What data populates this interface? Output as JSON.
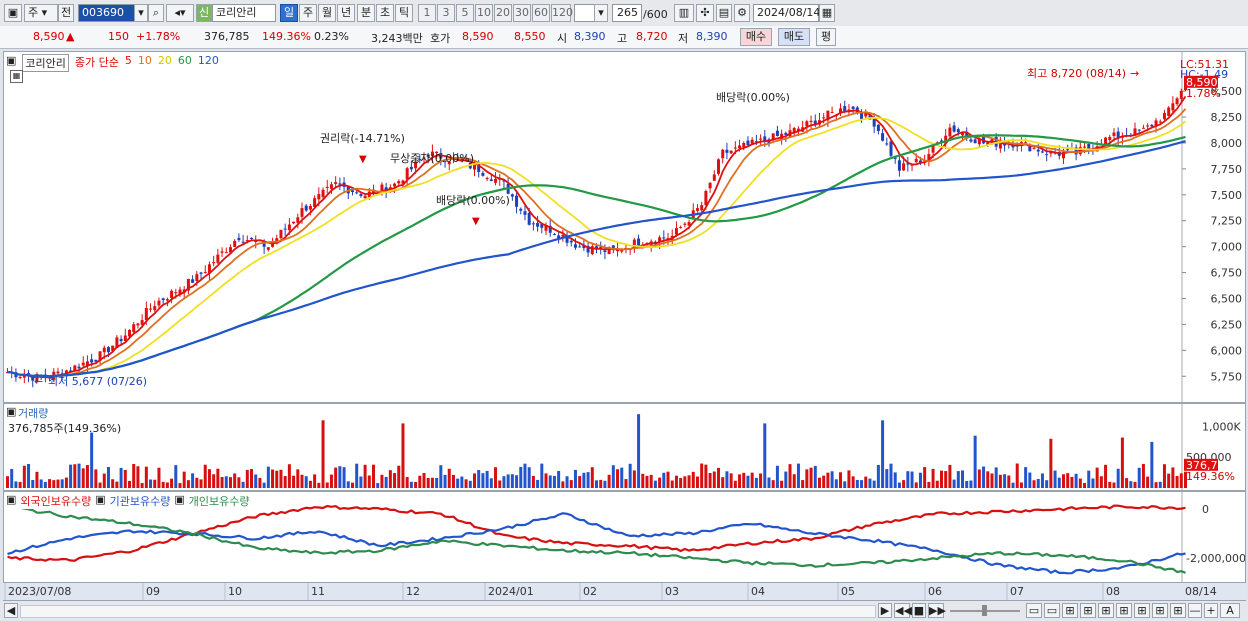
{
  "toolbar": {
    "mode1": "주",
    "mode2": "전",
    "code": "003690",
    "name_badge": "신",
    "name": "코리안리",
    "periods": [
      "일",
      "주",
      "월",
      "년",
      "분",
      "초",
      "틱"
    ],
    "numbers": [
      "1",
      "3",
      "5",
      "10",
      "20",
      "30",
      "60",
      "120"
    ],
    "count": "265",
    "count_total": "/600",
    "date": "2024/08/14"
  },
  "info": {
    "price": "8,590",
    "arrow": "▲",
    "change": "150",
    "change_pct": "+1.78%",
    "volume": "376,785",
    "volume_ratio": "149.36%",
    "turnover": "0.23%",
    "amount": "3,243백만",
    "quote_label": "호가",
    "ask": "8,590",
    "bid": "8,550",
    "open_label": "시",
    "open": "8,390",
    "high_label": "고",
    "high": "8,720",
    "low_label": "저",
    "low": "8,390",
    "buy": "매수",
    "sell": "매도",
    "avg": "평"
  },
  "price_panel": {
    "title": "코리안리",
    "close_label": "종가 단순",
    "ma": [
      "5",
      "10",
      "20",
      "60",
      "120"
    ],
    "ma_colors": [
      "#e01010",
      "#e07020",
      "#f0e020",
      "#229944",
      "#2255cc"
    ],
    "lc": "LC:51.31",
    "hc": "HC:-1.49",
    "last_price": "8,590",
    "last_pct": "1.78%",
    "high_note": "최고 8,720 (08/14)",
    "low_note": "최저 5,677 (07/26)",
    "events": [
      "권리락(-14.71%)",
      "무상증자(0.00%)",
      "배당락(0.00%)",
      "배당락(0.00%)"
    ]
  },
  "volume_panel": {
    "title": "거래량",
    "current": "376,785주(149.36%)",
    "ticks": [
      "1,000K",
      "500,000"
    ],
    "last_value": "376,785",
    "last_pct": "149.36%"
  },
  "holding_panel": {
    "legend": [
      "외국인보유수량",
      "기관보유수량",
      "개인보유수량"
    ],
    "colors": [
      "#d61010",
      "#2255cc",
      "#2e8b4e"
    ],
    "ticks": [
      "0",
      "-2,000,000"
    ]
  },
  "x_axis": {
    "labels": [
      "2023/07/08",
      "09",
      "10",
      "11",
      "12",
      "2024/01",
      "02",
      "03",
      "04",
      "05",
      "06",
      "07",
      "08"
    ],
    "current_date": "08/14"
  },
  "chart_data": {
    "type": "candlestick",
    "y_ticks": [
      5750,
      6000,
      6250,
      6500,
      6750,
      7000,
      7250,
      7500,
      7750,
      8000,
      8250,
      8500
    ],
    "ylim": [
      5550,
      8800
    ],
    "close_path": [
      [
        0,
        5790
      ],
      [
        8,
        5730
      ],
      [
        15,
        5820
      ],
      [
        22,
        5950
      ],
      [
        28,
        6150
      ],
      [
        35,
        6450
      ],
      [
        45,
        6700
      ],
      [
        55,
        7100
      ],
      [
        62,
        7000
      ],
      [
        70,
        7350
      ],
      [
        78,
        7600
      ],
      [
        85,
        7500
      ],
      [
        92,
        7600
      ],
      [
        100,
        7900
      ],
      [
        105,
        7850
      ],
      [
        112,
        7750
      ],
      [
        118,
        7600
      ],
      [
        124,
        7250
      ],
      [
        130,
        7150
      ],
      [
        136,
        7000
      ],
      [
        144,
        6950
      ],
      [
        150,
        7050
      ],
      [
        158,
        7100
      ],
      [
        165,
        7400
      ],
      [
        170,
        7900
      ],
      [
        178,
        8000
      ],
      [
        186,
        8100
      ],
      [
        194,
        8250
      ],
      [
        200,
        8350
      ],
      [
        206,
        8200
      ],
      [
        212,
        7750
      ],
      [
        218,
        7850
      ],
      [
        224,
        8150
      ],
      [
        232,
        8000
      ],
      [
        240,
        8000
      ],
      [
        248,
        7900
      ],
      [
        254,
        7900
      ],
      [
        262,
        8050
      ],
      [
        270,
        8120
      ],
      [
        276,
        8300
      ],
      [
        280,
        8590
      ]
    ],
    "total_days": 280,
    "volume_spikes": [
      [
        20,
        900000
      ],
      [
        75,
        1100000
      ],
      [
        94,
        1050000
      ],
      [
        150,
        1200000
      ],
      [
        180,
        1050000
      ],
      [
        208,
        1100000
      ],
      [
        230,
        850000
      ],
      [
        248,
        800000
      ],
      [
        265,
        820000
      ],
      [
        272,
        750000
      ]
    ],
    "holdings": {
      "foreign": [
        -2000000,
        -2100000,
        -1700000,
        -1000000,
        -300000,
        100000,
        0,
        -200000,
        -1100000,
        -1400000,
        -1500000,
        -1700000,
        -1400000,
        -1200000,
        -600000,
        -200000,
        -100000,
        0,
        100000,
        50000
      ],
      "institution": [
        -1800000,
        -1200000,
        -900000,
        -1000000,
        -1200000,
        -900000,
        -1500000,
        -1200000,
        -800000,
        -200000,
        -1100000,
        -1000000,
        -600000,
        -1000000,
        -1300000,
        -1700000,
        -2300000,
        -2600000,
        -2400000,
        -1800000
      ],
      "individual": [
        100000,
        -300000,
        -600000,
        -1000000,
        -1600000,
        -1800000,
        -1700000,
        -1300000,
        -1500000,
        -1700000,
        -1800000,
        -2000000,
        -2200000,
        -2300000,
        -2200000,
        -2000000,
        -1800000,
        -1900000,
        -2100000,
        -2600000
      ]
    }
  }
}
